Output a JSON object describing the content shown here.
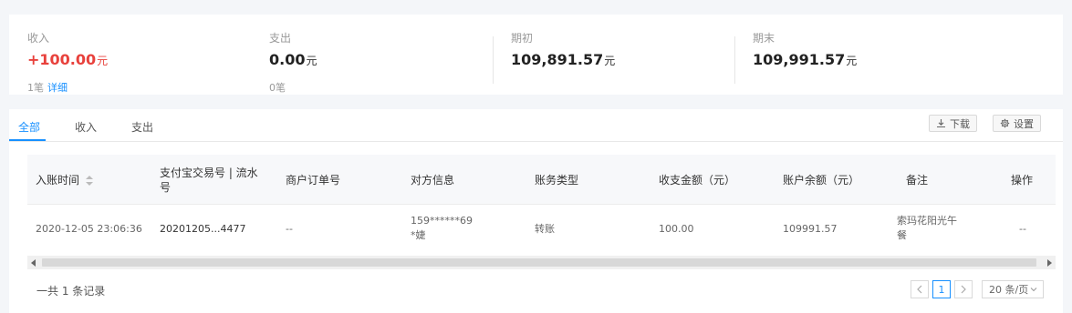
{
  "summary": {
    "income": {
      "label": "收入",
      "amount": "+100.00",
      "unit": "元",
      "count": "1笔",
      "detail_link": "详细"
    },
    "expense": {
      "label": "支出",
      "amount": "0.00",
      "unit": "元",
      "count": "0笔"
    },
    "opening": {
      "label": "期初",
      "amount": "109,891.57",
      "unit": "元"
    },
    "closing": {
      "label": "期末",
      "amount": "109,991.57",
      "unit": "元"
    }
  },
  "tabs": [
    {
      "label": "全部",
      "active": true
    },
    {
      "label": "收入",
      "active": false
    },
    {
      "label": "支出",
      "active": false
    }
  ],
  "toolbar": {
    "download_label": "下载",
    "settings_label": "设置"
  },
  "table": {
    "headers": {
      "time": "入账时间",
      "alipay_no_line1": "支付宝交易号 | 流水",
      "alipay_no_line2": "号",
      "merchant_order": "商户订单号",
      "counterparty": "对方信息",
      "account_type": "账务类型",
      "amount": "收支金额（元）",
      "balance": "账户余额（元）",
      "remark": "备注",
      "action": "操作"
    },
    "rows": [
      {
        "time": "2020-12-05 23:06:36",
        "alipay_no": "20201205...4477",
        "merchant_order": "--",
        "counterparty_line1": "159******69",
        "counterparty_line2": "*婕",
        "account_type": "转账",
        "amount": "100.00",
        "balance": "109991.57",
        "remark_line1": "索玛花阳光午",
        "remark_line2": "餐",
        "action": "--"
      }
    ]
  },
  "pagination": {
    "total_text": "一共 1 条记录",
    "current_page": "1",
    "page_size": "20 条/页"
  },
  "colors": {
    "accent": "#1890ff",
    "income": "#e8413c"
  }
}
